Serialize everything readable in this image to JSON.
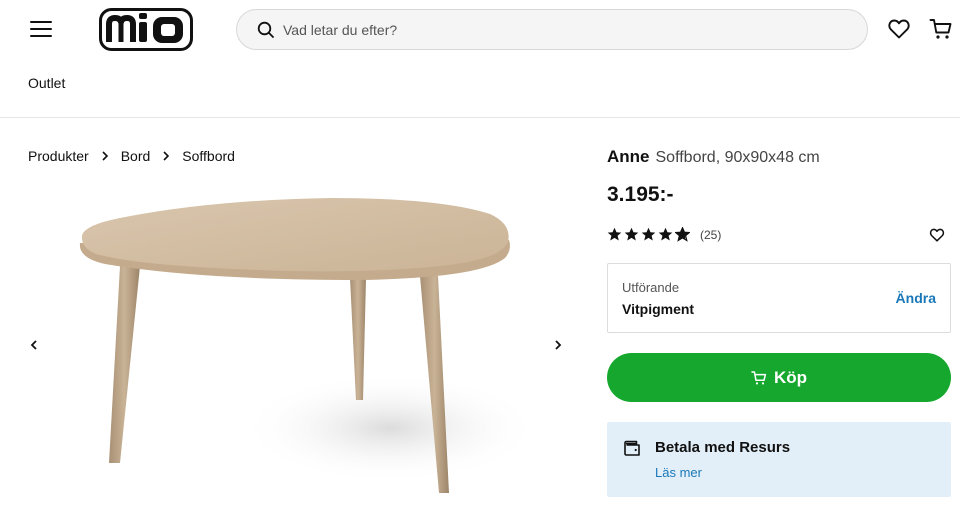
{
  "header": {
    "logo_text": "mio",
    "search_placeholder": "Vad letar du efter?",
    "nav_outlet": "Outlet"
  },
  "breadcrumb": [
    "Produkter",
    "Bord",
    "Soffbord"
  ],
  "product": {
    "brand": "Anne",
    "description": "Soffbord, 90x90x48 cm",
    "price": "3.195:-",
    "rating": 4.5,
    "rating_count": "(25)",
    "variant_label": "Utförande",
    "variant_value": "Vitpigment",
    "variant_change": "Ändra",
    "buy_label": "Köp",
    "payment_title": "Betala med Resurs",
    "payment_link": "Läs mer"
  },
  "colors": {
    "buy_button": "#16a82e",
    "link": "#1a78b8",
    "payment_bg": "#e3eff8"
  }
}
